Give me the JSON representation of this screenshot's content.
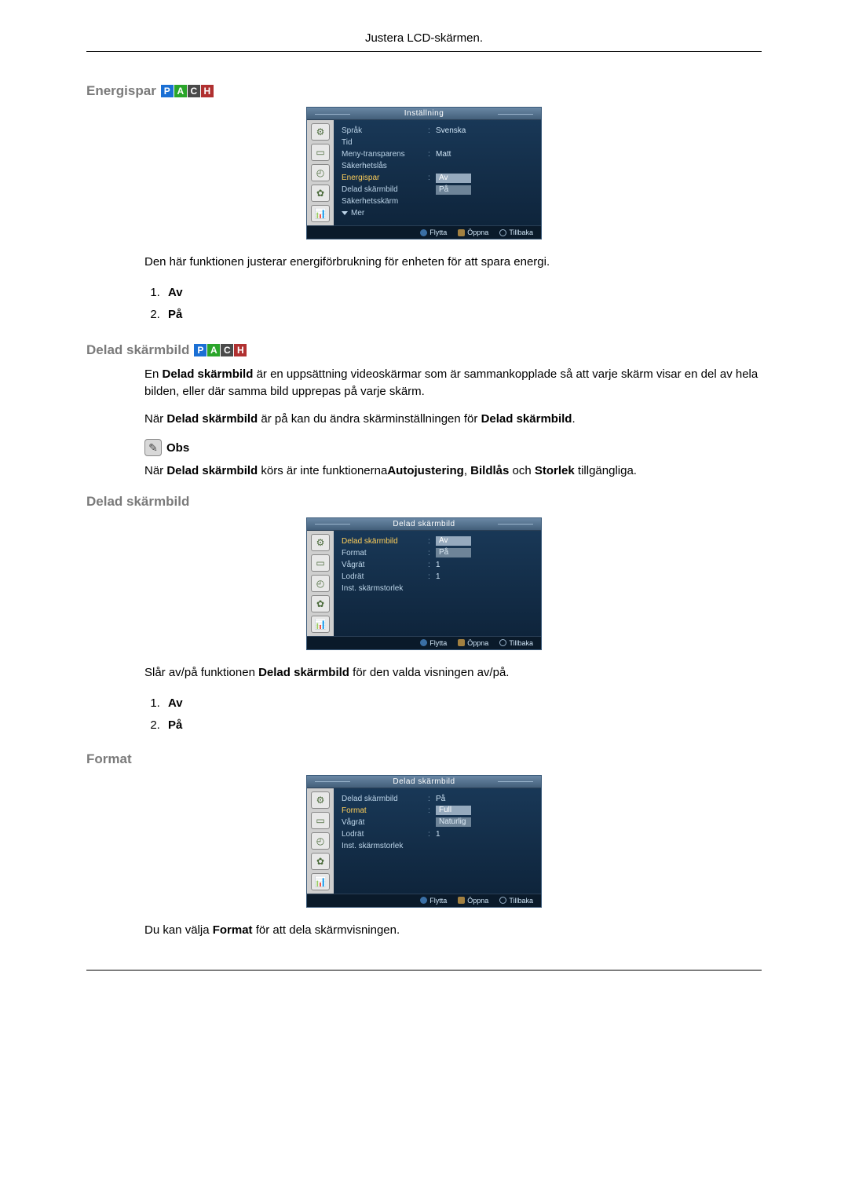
{
  "page_header": "Justera LCD-skärmen.",
  "pach_letters": {
    "p": "P",
    "a": "A",
    "c": "C",
    "h": "H"
  },
  "sections": {
    "energispar": {
      "heading": "Energispar",
      "desc": "Den här funktionen justerar energiförbrukning för enheten för att spara energi.",
      "options": {
        "o1": "Av",
        "o2": "På"
      },
      "osd": {
        "title": "Inställning",
        "rows": {
          "sprak": {
            "label": "Språk",
            "value": "Svenska"
          },
          "tid": {
            "label": "Tid",
            "value": ""
          },
          "meny": {
            "label": "Meny-transparens",
            "value": "Matt"
          },
          "sakerhetslas": {
            "label": "Säkerhetslås",
            "value": ""
          },
          "energispar": {
            "label": "Energispar",
            "valAv": "Av",
            "valPa": "På"
          },
          "delad": {
            "label": "Delad skärmbild",
            "value": ""
          },
          "sakerhetsskarm": {
            "label": "Säkerhetsskärm",
            "value": ""
          },
          "mer": {
            "label": "Mer"
          }
        },
        "footer": {
          "move": "Flytta",
          "open": "Öppna",
          "back": "Tillbaka"
        }
      }
    },
    "delad_intro": {
      "heading": "Delad skärmbild",
      "p1_a": "En ",
      "p1_b": "Delad skärmbild",
      "p1_c": " är en uppsättning videoskärmar som är sammankopplade så att varje skärm visar en del av hela bilden, eller där samma bild upprepas på varje skärm.",
      "p2_a": "När ",
      "p2_b": "Delad skärmbild",
      "p2_c": " är på kan du ändra skärminställningen för ",
      "p2_d": "Delad skärmbild",
      "p2_e": ".",
      "obs": "Obs",
      "p3_a": "När ",
      "p3_b": "Delad skärmbild",
      "p3_c": " körs är inte funktionerna",
      "p3_d": "Autojustering",
      "p3_e": ", ",
      "p3_f": "Bildlås",
      "p3_g": "  och ",
      "p3_h": "Storlek",
      "p3_i": " tillgängliga."
    },
    "delad": {
      "heading": "Delad skärmbild",
      "desc_a": "Slår av/på funktionen ",
      "desc_b": "Delad skärmbild",
      "desc_c": " för den valda visningen av/på.",
      "options": {
        "o1": "Av",
        "o2": "På"
      },
      "osd": {
        "title": "Delad skärmbild",
        "rows": {
          "delad": {
            "label": "Delad skärmbild",
            "valAv": "Av",
            "valPa": "På"
          },
          "format": {
            "label": "Format",
            "value": ""
          },
          "vagrat": {
            "label": "Vågrät",
            "value": "1"
          },
          "lodrat": {
            "label": "Lodrät",
            "value": "1"
          },
          "inst": {
            "label": "Inst. skärmstorlek",
            "value": ""
          }
        },
        "footer": {
          "move": "Flytta",
          "open": "Öppna",
          "back": "Tillbaka"
        }
      }
    },
    "format": {
      "heading": "Format",
      "desc_a": "Du kan välja ",
      "desc_b": "Format",
      "desc_c": " för att dela skärmvisningen.",
      "osd": {
        "title": "Delad skärmbild",
        "rows": {
          "delad": {
            "label": "Delad skärmbild",
            "value": "På"
          },
          "format": {
            "label": "Format",
            "valFull": "Full",
            "valNat": "Naturlig"
          },
          "vagrat": {
            "label": "Vågrät",
            "value": ""
          },
          "lodrat": {
            "label": "Lodrät",
            "value": "1"
          },
          "inst": {
            "label": "Inst. skärmstorlek",
            "value": ""
          }
        },
        "footer": {
          "move": "Flytta",
          "open": "Öppna",
          "back": "Tillbaka"
        }
      }
    }
  }
}
